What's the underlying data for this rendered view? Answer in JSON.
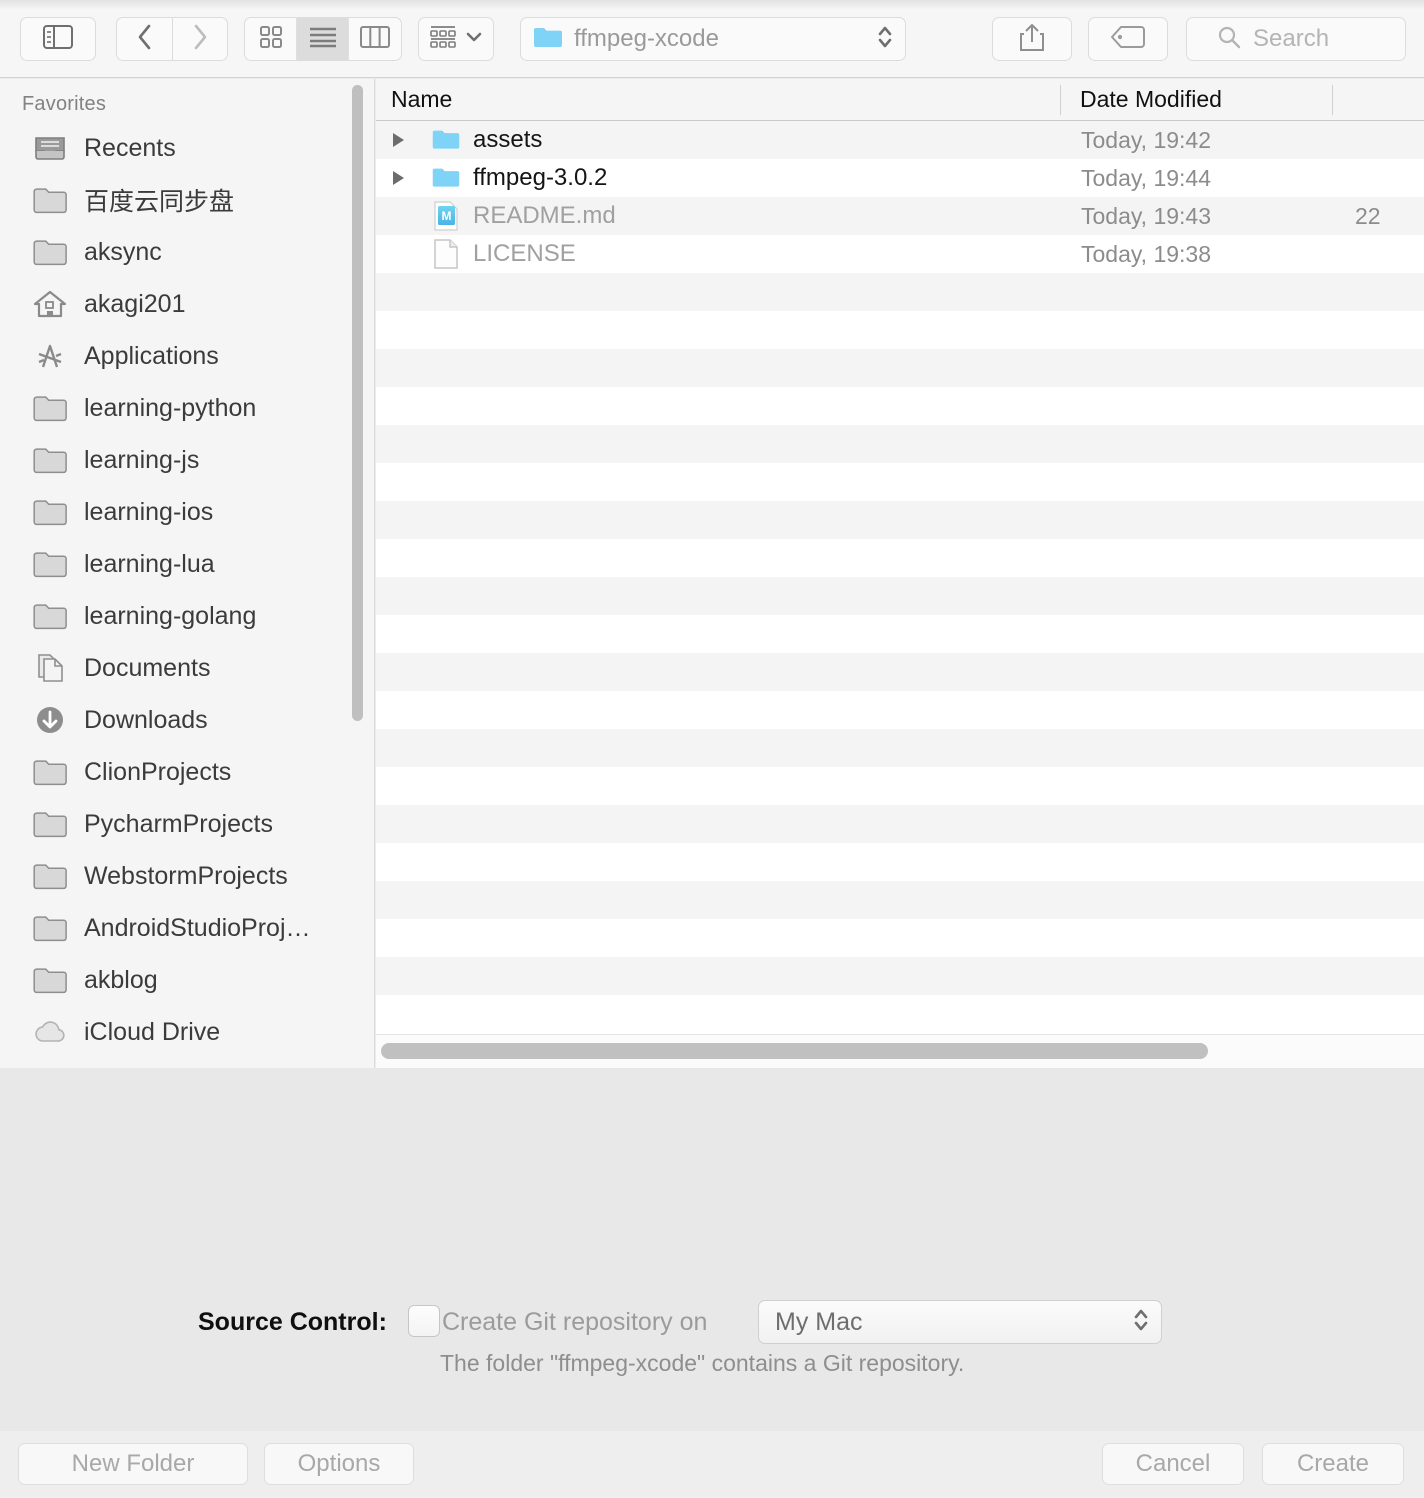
{
  "toolbar": {
    "sidebar_toggle_icon": "sidebar-toggle-icon",
    "back_icon": "chevron-left-icon",
    "forward_icon": "chevron-right-icon",
    "view_modes": [
      {
        "name": "icon-view",
        "icon": "grid-icon",
        "active": false
      },
      {
        "name": "list-view",
        "icon": "list-icon",
        "active": true
      },
      {
        "name": "column-view",
        "icon": "columns-icon",
        "active": false
      }
    ],
    "arrange_icon": "arrange-icon",
    "arrange_chevron_icon": "chevron-down-icon",
    "path": {
      "folder_icon": "folder-icon",
      "label": "ffmpeg-xcode",
      "stepper_icon": "updown-chevron-icon"
    },
    "share_icon": "share-icon",
    "tag_icon": "tag-icon",
    "search": {
      "icon": "search-icon",
      "placeholder": "Search",
      "value": ""
    }
  },
  "sidebar": {
    "section_title": "Favorites",
    "items": [
      {
        "label": "Recents",
        "icon": "recents-icon"
      },
      {
        "label": "百度云同步盘",
        "icon": "folder-icon"
      },
      {
        "label": "aksync",
        "icon": "folder-icon"
      },
      {
        "label": "akagi201",
        "icon": "home-icon"
      },
      {
        "label": "Applications",
        "icon": "applications-icon"
      },
      {
        "label": "learning-python",
        "icon": "folder-icon"
      },
      {
        "label": "learning-js",
        "icon": "folder-icon"
      },
      {
        "label": "learning-ios",
        "icon": "folder-icon"
      },
      {
        "label": "learning-lua",
        "icon": "folder-icon"
      },
      {
        "label": "learning-golang",
        "icon": "folder-icon"
      },
      {
        "label": "Documents",
        "icon": "documents-icon"
      },
      {
        "label": "Downloads",
        "icon": "downloads-icon"
      },
      {
        "label": "ClionProjects",
        "icon": "folder-icon"
      },
      {
        "label": "PycharmProjects",
        "icon": "folder-icon"
      },
      {
        "label": "WebstormProjects",
        "icon": "folder-icon"
      },
      {
        "label": "AndroidStudioProj…",
        "icon": "folder-icon"
      },
      {
        "label": "akblog",
        "icon": "folder-icon"
      },
      {
        "label": "iCloud Drive",
        "icon": "icloud-icon"
      }
    ]
  },
  "file_list": {
    "columns": [
      "Name",
      "Date Modified",
      ""
    ],
    "rows": [
      {
        "name": "assets",
        "date": "Today, 19:42",
        "size": "",
        "icon": "folder-icon",
        "disclosure": true,
        "dim": false
      },
      {
        "name": "ffmpeg-3.0.2",
        "date": "Today, 19:44",
        "size": "",
        "icon": "folder-icon",
        "disclosure": true,
        "dim": false
      },
      {
        "name": "README.md",
        "date": "Today, 19:43",
        "size": "22",
        "icon": "markdown-icon",
        "disclosure": false,
        "dim": true
      },
      {
        "name": "LICENSE",
        "date": "Today, 19:38",
        "size": "",
        "icon": "document-icon",
        "disclosure": false,
        "dim": true
      }
    ],
    "empty_rows": 19
  },
  "accessory": {
    "source_control_label": "Source Control:",
    "git_checkbox_label": "Create Git repository on",
    "git_checkbox_checked": false,
    "location_value": "My Mac",
    "note": "The folder \"ffmpeg-xcode\" contains a Git repository."
  },
  "bottom_bar": {
    "new_folder_label": "New Folder",
    "options_label": "Options",
    "cancel_label": "Cancel",
    "create_label": "Create"
  },
  "colors": {
    "folder_blue": "#7fd3f7",
    "markdown_blue": "#5ec9ee",
    "toolbar_bg": "#f6f6f6",
    "sidebar_bg": "#f5f5f5",
    "row_stripe": "#f4f4f4",
    "accessory_bg": "#e8e8e8"
  }
}
